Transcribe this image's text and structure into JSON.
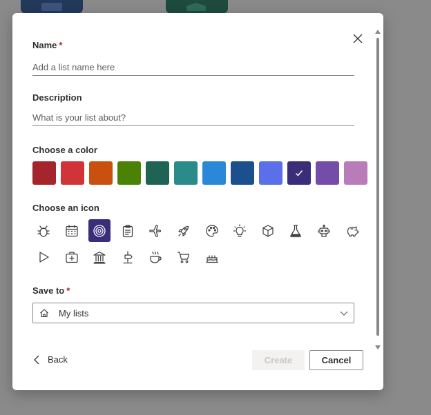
{
  "name": {
    "label": "Name",
    "required_mark": "*",
    "placeholder": "Add a list name here",
    "value": ""
  },
  "description": {
    "label": "Description",
    "placeholder": "What is your list about?",
    "value": ""
  },
  "color": {
    "label": "Choose a color",
    "swatches": [
      "#a4262c",
      "#d13438",
      "#ca5010",
      "#498205",
      "#1e6354",
      "#2b8a8a",
      "#2b88d8",
      "#1b4f8e",
      "#5b6fe8",
      "#3a2d7a",
      "#744da9",
      "#b87db8"
    ],
    "selected_index": 9
  },
  "icon": {
    "label": "Choose an icon",
    "items": [
      "bug-icon",
      "calendar-icon",
      "target-icon",
      "clipboard-icon",
      "airplane-icon",
      "rocket-icon",
      "palette-icon",
      "lightbulb-icon",
      "cube-icon",
      "flask-icon",
      "robot-icon",
      "piggy-bank-icon",
      "play-icon",
      "first-aid-icon",
      "bank-icon",
      "signpost-icon",
      "coffee-icon",
      "cart-icon",
      "cake-icon"
    ],
    "selected": "target-icon"
  },
  "save_to": {
    "label": "Save to",
    "required_mark": "*",
    "value": "My lists"
  },
  "footer": {
    "back_label": "Back",
    "create_label": "Create",
    "cancel_label": "Cancel"
  }
}
